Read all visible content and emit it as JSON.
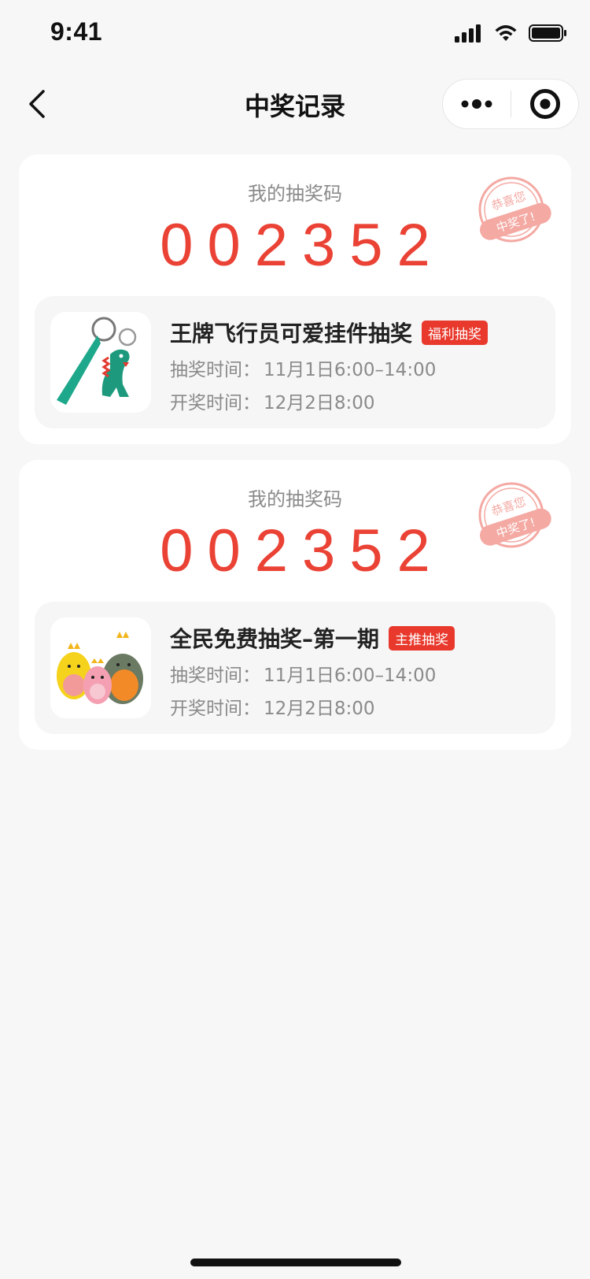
{
  "status_bar": {
    "time": "9:41"
  },
  "nav": {
    "title": "中奖记录"
  },
  "records": [
    {
      "code_label": "我的抽奖码",
      "code": "002352",
      "stamp_line1": "恭喜您",
      "stamp_line2": "中奖了!",
      "prize_title": "王牌飞行员可爱挂件抽奖",
      "tag": "福利抽奖",
      "draw_time_label": "抽奖时间：",
      "draw_time": "11月1日6:00–14:00",
      "open_time_label": "开奖时间：",
      "open_time": "12月2日8:00"
    },
    {
      "code_label": "我的抽奖码",
      "code": "002352",
      "stamp_line1": "恭喜您",
      "stamp_line2": "中奖了!",
      "prize_title": "全民免费抽奖–第一期",
      "tag": "主推抽奖",
      "draw_time_label": "抽奖时间：",
      "draw_time": "11月1日6:00–14:00",
      "open_time_label": "开奖时间：",
      "open_time": "12月2日8:00"
    }
  ],
  "colors": {
    "accent": "#ea4235",
    "tag_bg": "#e8392c",
    "stamp": "#f4a9a3"
  }
}
